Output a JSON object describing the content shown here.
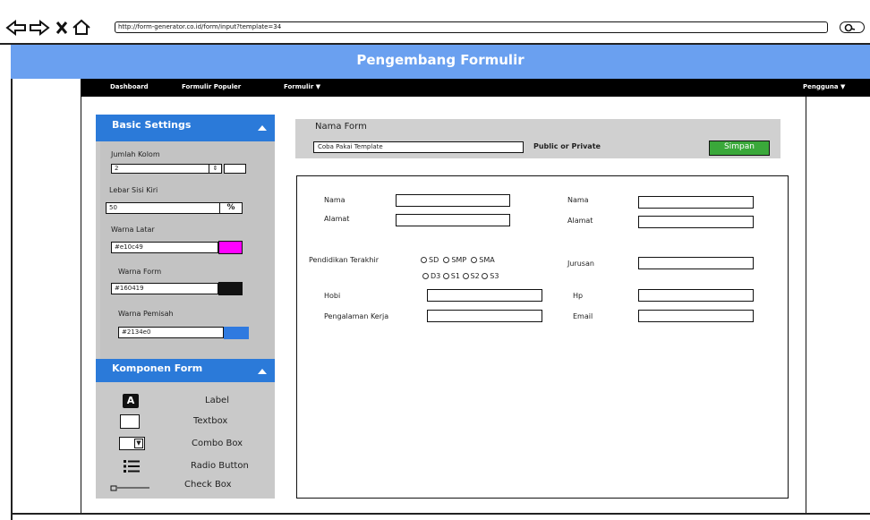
{
  "browser": {
    "url": "http://form-generator.co.id/form/input?template=34"
  },
  "banner": {
    "title": "Pengembang Formulir"
  },
  "nav": {
    "items": [
      "Dashboard",
      "Formulir Populer",
      "Formulir"
    ],
    "user": "Pengguna"
  },
  "basic_settings": {
    "title": "Basic Settings",
    "jumlah_kolom_label": "Jumlah Kolom",
    "jumlah_kolom_value": "2",
    "lebar_label": "Lebar Sisi Kiri",
    "lebar_value": "50",
    "lebar_unit": "%",
    "warna_latar_label": "Warna Latar",
    "warna_latar_value": "#e10c49",
    "warna_form_label": "Warna Form",
    "warna_form_value": "#160419",
    "warna_pemisah_label": "Warna Pemisah",
    "warna_pemisah_value": "#2134e0",
    "colors": {
      "latar": "#ff00ff",
      "form": "#111111",
      "pemisah": "#2f7ae0"
    }
  },
  "komponen": {
    "title": "Komponen Form",
    "items": [
      "Label",
      "Textbox",
      "Combo Box",
      "Radio Button",
      "Check Box"
    ]
  },
  "form_header": {
    "nama_form_label": "Nama Form",
    "nama_form_value": "Coba Pakai Template",
    "visibility_label": "Public or Private",
    "save_label": "Simpan"
  },
  "canvas": {
    "left": {
      "nama": "Nama",
      "alamat": "Alamat",
      "pendidikan": "Pendidikan Terakhir",
      "hobi": "Hobi",
      "pengalaman": "Pengalaman Kerja"
    },
    "right": {
      "nama": "Nama",
      "alamat": "Alamat",
      "jurusan": "Jurusan",
      "hp": "Hp",
      "email": "Email"
    },
    "pendidikan_options_row1": [
      "SD",
      "SMP",
      "SMA"
    ],
    "pendidikan_options_row2": [
      "D3",
      "S1",
      "S2",
      "S3"
    ]
  }
}
